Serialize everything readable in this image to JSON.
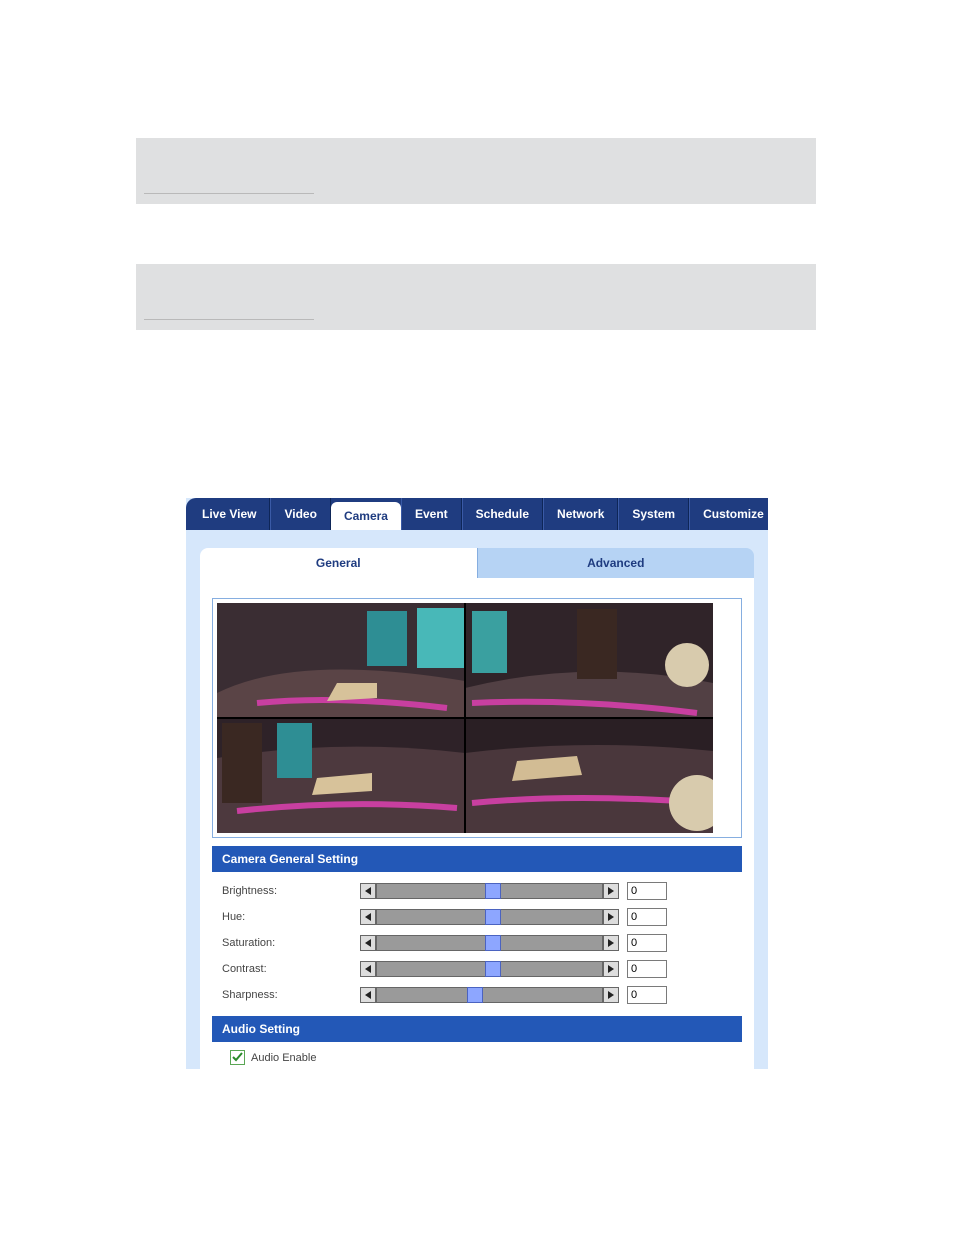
{
  "topnav": {
    "tabs": [
      "Live View",
      "Video",
      "Camera",
      "Event",
      "Schedule",
      "Network",
      "System",
      "Customize"
    ],
    "active_index": 2
  },
  "subtabs": {
    "items": [
      "General",
      "Advanced"
    ],
    "active_index": 0
  },
  "camera_general": {
    "title": "Camera General Setting",
    "sliders": [
      {
        "label": "Brightness:",
        "value": "0",
        "thumb_pct": 48
      },
      {
        "label": "Hue:",
        "value": "0",
        "thumb_pct": 48
      },
      {
        "label": "Saturation:",
        "value": "0",
        "thumb_pct": 48
      },
      {
        "label": "Contrast:",
        "value": "0",
        "thumb_pct": 48
      },
      {
        "label": "Sharpness:",
        "value": "0",
        "thumb_pct": 40
      }
    ]
  },
  "audio": {
    "title": "Audio Setting",
    "enable_label": "Audio Enable",
    "enable_checked": true
  }
}
